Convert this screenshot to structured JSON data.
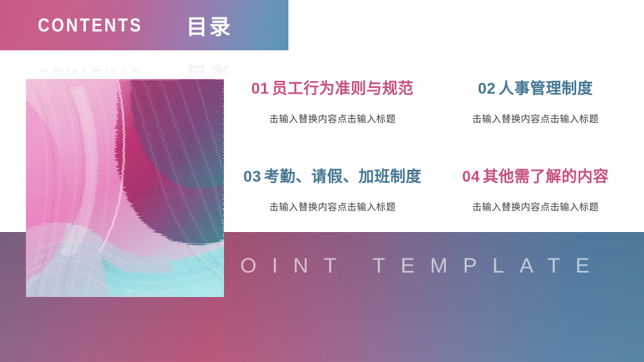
{
  "header": {
    "english_title": "CONTENTS",
    "chinese_title": "目录"
  },
  "colors": {
    "pink": "#c74f7f",
    "blue": "#437691",
    "band_left": "#bf5e84",
    "band_right": "#5a8fae",
    "caption": "rgba(255,255,255,0.62)"
  },
  "picture": {
    "alt_name": "silk-fabric-gradient-texture"
  },
  "content": {
    "items": [
      {
        "number": "01",
        "title": "员工行为准则与规范",
        "subtitle": "击输入替换内容点击输入标题",
        "color_key": "pink"
      },
      {
        "number": "02",
        "title": "人事管理制度",
        "subtitle": "击输入替换内容点击输入标题",
        "color_key": "blue"
      },
      {
        "number": "03",
        "title": "考勤、请假、加班制度",
        "subtitle": "击输入替换内容点击输入标题",
        "color_key": "blue"
      },
      {
        "number": "04",
        "title": "其他需了解的内容",
        "subtitle": "击输入替换内容点击输入标题",
        "color_key": "pink"
      }
    ]
  },
  "footer": {
    "caption": "POWERPOINT TEMPLATE"
  }
}
